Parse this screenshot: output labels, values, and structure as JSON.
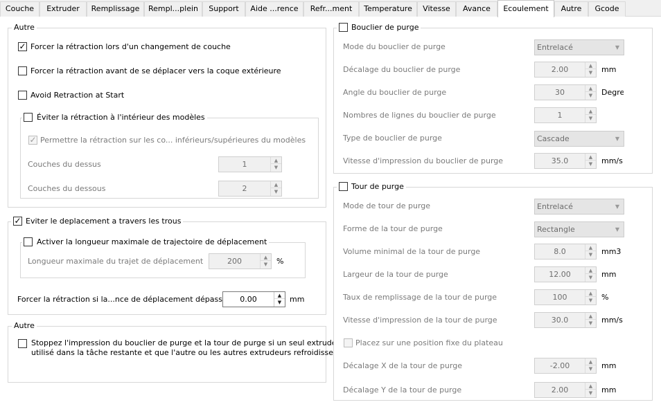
{
  "tabs": [
    "Couche",
    "Extruder",
    "Remplissage",
    "Rempl...plein",
    "Support",
    "Aide ...rence",
    "Refr...ment",
    "Temperature",
    "Vitesse",
    "Avance",
    "Ecoulement",
    "Autre",
    "Gcode"
  ],
  "active_tab": "Ecoulement",
  "left": {
    "group1": {
      "title": "Autre",
      "force_retract_layer": {
        "label": "Forcer la rétraction lors d'un changement de couche",
        "checked": true
      },
      "force_retract_outer": {
        "label": "Forcer la rétraction avant de se déplacer vers la coque extérieure",
        "checked": false
      },
      "avoid_retract_start": {
        "label": "Avoid Retraction at Start",
        "checked": false
      },
      "inner": {
        "title": "Éviter la rétraction à l'intérieur des modèles",
        "checked": false,
        "allow_retract": {
          "label": "Permettre la rétraction sur les co... inférieurs/supérieures du modèles",
          "checked": true
        },
        "top_layers": {
          "label": "Couches du dessus",
          "value": "1"
        },
        "bottom_layers": {
          "label": "Couches du dessous",
          "value": "2"
        }
      }
    },
    "group2": {
      "title": "Eviter le deplacement a travers les trous",
      "checked": true,
      "inner": {
        "title": "Activer la longueur maximale de trajectoire de déplacement",
        "checked": false,
        "max_length": {
          "label": "Longueur maximale du trajet de déplacement",
          "value": "200",
          "unit": "%"
        }
      },
      "force_retract_dist": {
        "label": "Forcer la rétraction si la...nce de déplacement dépasse",
        "value": "0.00",
        "unit": "mm"
      }
    },
    "group3": {
      "title": "Autre",
      "stop_shield": {
        "label_line1": "Stoppez l'impression du bouclier de purge et la tour de purge si un seul extrudeur est",
        "label_line2": "utilisé dans la tâche restante et que l'autre ou les autres extrudeurs refroidissent",
        "checked": false
      }
    }
  },
  "right": {
    "shield": {
      "title": "Bouclier de purge",
      "checked": false,
      "rows": [
        {
          "label": "Mode du bouclier de purge",
          "type": "combo",
          "value": "Entrelacé",
          "unit": ""
        },
        {
          "label": "Décalage du bouclier de purge",
          "type": "spin",
          "value": "2.00",
          "unit": "mm"
        },
        {
          "label": "Angle du bouclier de purge",
          "type": "spin",
          "value": "30",
          "unit": "Degres"
        },
        {
          "label": "Nombres de lignes du bouclier de purge",
          "type": "spin",
          "value": "1",
          "unit": ""
        },
        {
          "label": "Type de bouclier de purge",
          "type": "combo",
          "value": "Cascade",
          "unit": ""
        },
        {
          "label": "Vitesse d'impression du bouclier de purge",
          "type": "spin",
          "value": "35.0",
          "unit": "mm/s"
        }
      ]
    },
    "tower": {
      "title": "Tour de purge",
      "checked": false,
      "rows": [
        {
          "label": "Mode de tour de purge",
          "type": "combo",
          "value": "Entrelacé",
          "unit": ""
        },
        {
          "label": "Forme de la tour de purge",
          "type": "combo",
          "value": "Rectangle",
          "unit": ""
        },
        {
          "label": "Volume minimal de la tour de purge",
          "type": "spin",
          "value": "8.0",
          "unit": "mm3"
        },
        {
          "label": "Largeur de la tour de purge",
          "type": "spin",
          "value": "12.00",
          "unit": "mm"
        },
        {
          "label": "Taux de remplissage de la tour de purge",
          "type": "spin",
          "value": "100",
          "unit": "%"
        },
        {
          "label": "Vitesse d'impression de la tour de purge",
          "type": "spin",
          "value": "30.0",
          "unit": "mm/s"
        }
      ],
      "fixed_position": {
        "label": "Placez sur une position fixe du plateau",
        "checked": false
      },
      "rows2": [
        {
          "label": "Décalage X de la tour de purge",
          "type": "spin",
          "value": "-2.00",
          "unit": "mm"
        },
        {
          "label": "Décalage Y de la tour de purge",
          "type": "spin",
          "value": "2.00",
          "unit": "mm"
        }
      ]
    }
  },
  "icons": {
    "check": "✓",
    "up": "▲",
    "down": "▼",
    "chevron": "▼"
  }
}
